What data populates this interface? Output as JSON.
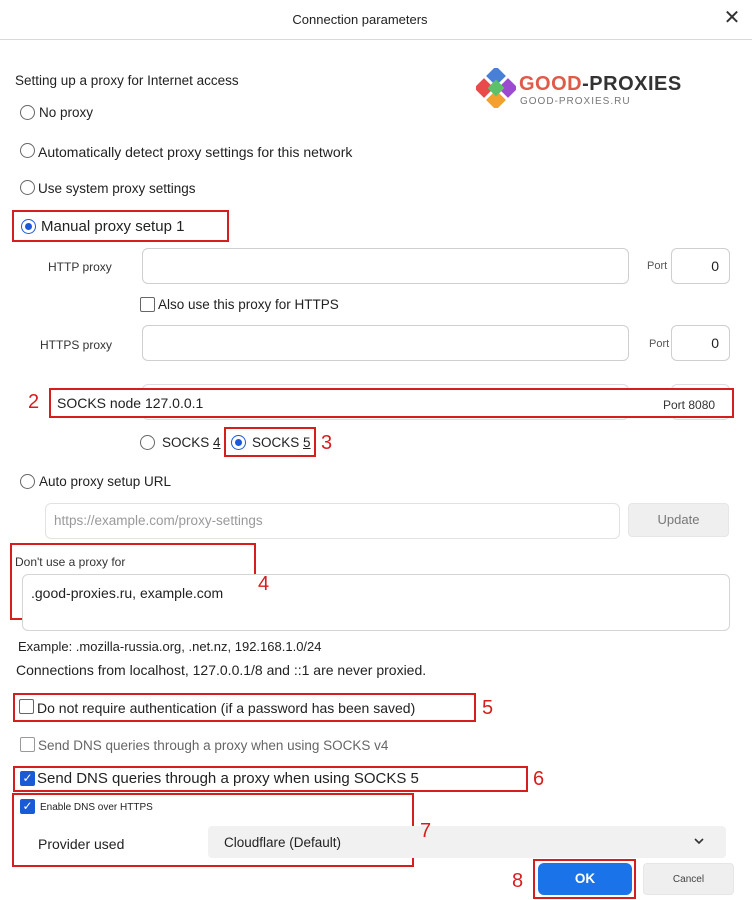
{
  "window": {
    "title": "Connection parameters"
  },
  "logo": {
    "name_part1": "GOOD",
    "name_part2": "-PROXIES",
    "subtitle": "GOOD-PROXIES.RU"
  },
  "section": {
    "heading": "Setting up a proxy for Internet access"
  },
  "options": {
    "no_proxy": "No proxy",
    "auto_detect": "Automatically detect proxy settings for this network",
    "system": "Use system proxy settings",
    "manual": "Manual proxy setup",
    "auto_url": "Auto proxy setup URL"
  },
  "manual": {
    "http_label": "HTTP proxy",
    "http_port_label": "Port",
    "http_port": "0",
    "also_https": "Also use this proxy for HTTPS",
    "https_label": "HTTPS proxy",
    "https_port_label": "Port",
    "https_port": "0",
    "socks_text": "SOCKS node 127.0.0.1",
    "socks_port_text": "Port 8080",
    "socks4_prefix": "SOCKS ",
    "socks4_num": "4",
    "socks5_prefix": "SOCKS ",
    "socks5_num": "5"
  },
  "auto_url": {
    "placeholder": "https://example.com/proxy-settings",
    "update": "Update"
  },
  "no_proxy_for": {
    "label": "Don't use a proxy for",
    "value": ".good-proxies.ru, example.com",
    "example": "Example: .mozilla-russia.org, .net.nz, 192.168.1.0/24",
    "note": "Connections from localhost, 127.0.0.1/8 and ::1 are never proxied."
  },
  "auth": {
    "label": "Do not require authentication (if a password has been saved)",
    "checked": false
  },
  "dns4": {
    "label": "Send DNS queries through a proxy when using SOCKS v4",
    "checked": false
  },
  "dns5": {
    "label": "Send DNS queries through a proxy when using SOCKS 5",
    "checked": true
  },
  "doh": {
    "label": "Enable DNS over HTTPS",
    "checked": true,
    "provider_label": "Provider used",
    "provider_value": "Cloudflare (Default)"
  },
  "buttons": {
    "ok": "OK",
    "cancel": "Cancel"
  },
  "annotations": {
    "n1": "1",
    "n2": "2",
    "n3": "3",
    "n4": "4",
    "n5": "5",
    "n6": "6",
    "n7": "7",
    "n8": "8"
  },
  "colors": {
    "accent": "#1a73e8",
    "annotation_red": "#d51f1f"
  }
}
